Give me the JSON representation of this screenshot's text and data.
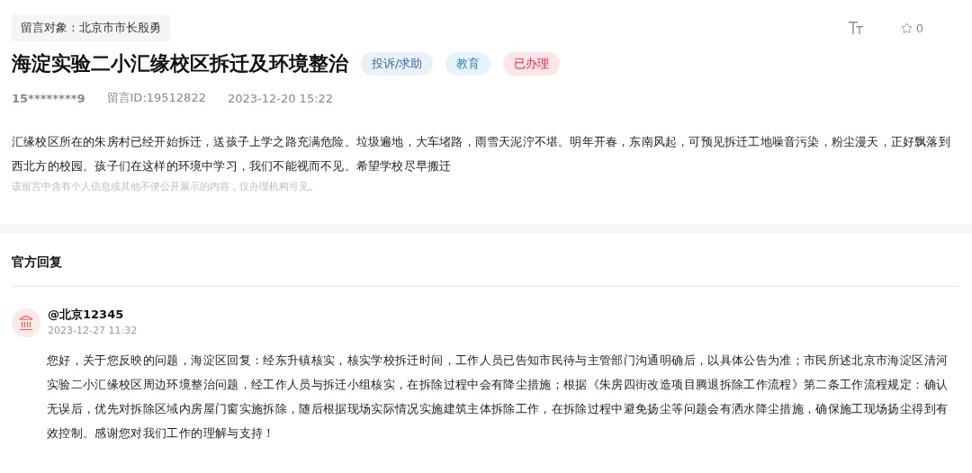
{
  "message": {
    "recipient_label": "留言对象：北京市市长殷勇",
    "title": "海淀实验二小汇缘校区拆迁及环境整治",
    "tags": [
      {
        "label": "投诉/求助",
        "color": "#eaf0f8"
      },
      {
        "label": "教育",
        "color": "#e6f3fb"
      },
      {
        "label": "已办理",
        "color": "#fde4e8"
      }
    ],
    "author": "15********9",
    "message_id": "留言ID:19512822",
    "time": "2023-12-20 15:22",
    "favorites": "0",
    "body": "汇缘校区所在的朱房村已经开始拆迁，送孩子上学之路充满危险。垃圾遍地，大车堵路，雨雪天泥泞不堪。明年开春，东南风起，可预见拆迁工地噪音污染，粉尘漫天，正好飘落到西北方的校园。孩子们在这样的环境中学习，我们不能视而不见。希望学校尽早搬迁",
    "privacy_note": "该留言中含有个人信息或其他不便公开展示的内容，仅办理机构可见。"
  },
  "official_reply": {
    "heading": "官方回复",
    "replier": "@北京12345",
    "time": "2023-12-27 11:32",
    "text": "您好，关于您反映的问题，海淀区回复：经东升镇核实，核实学校拆迁时间，工作人员已告知市民待与主管部门沟通明确后，以具体公告为准；市民所述北京市海淀区清河实验二小汇缘校区周边环境整治问题，经工作人员与拆迁小组核实，在拆除过程中会有降尘措施；根据《朱房四街改造项目腾退拆除工作流程》第二条工作流程规定：确认无误后，优先对拆除区域内房屋门窗实施拆除，随后根据现场实际情况实施建筑主体拆除工作，在拆除过程中避免扬尘等问题会有洒水降尘措施，确保施工现场扬尘得到有效控制。感谢您对我们工作的理解与支持！"
  }
}
